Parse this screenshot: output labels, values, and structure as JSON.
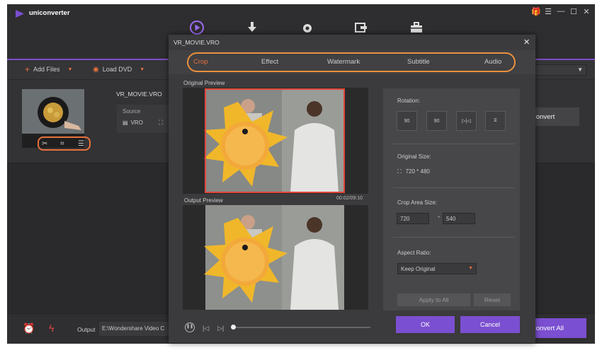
{
  "app": {
    "name": "uniconverter"
  },
  "window_controls": [
    "gift-icon",
    "menu-icon",
    "minimize-icon",
    "maximize-icon",
    "close-icon"
  ],
  "toolbar": {
    "add_files": "Add Files",
    "load_dvd": "Load DVD"
  },
  "file": {
    "name": "VR_MOVIE.VRO",
    "source_label": "Source",
    "source_format": "VRO"
  },
  "convert_button": "Convert",
  "bottom": {
    "output_label": "Output",
    "output_path": "E:\\Wondershare Video C",
    "convert_all": "Convert All"
  },
  "modal": {
    "title": "VR_MOVIE.VRO",
    "tabs": [
      {
        "label": "Crop",
        "active": true
      },
      {
        "label": "Effect",
        "active": false
      },
      {
        "label": "Watermark",
        "active": false
      },
      {
        "label": "Subtitle",
        "active": false
      },
      {
        "label": "Audio",
        "active": false
      }
    ],
    "original_preview_label": "Original Preview",
    "output_preview_label": "Output Preview",
    "timecode": "00:02/09:10",
    "rotation_label": "Rotation:",
    "rotation_buttons": [
      "90",
      "90"
    ],
    "original_size_label": "Original Size:",
    "original_size_value": "720 * 480",
    "crop_area_label": "Crop Area Size:",
    "crop_width": "720",
    "crop_height": "540",
    "crop_separator": "*",
    "aspect_ratio_label": "Aspect Ratio:",
    "aspect_ratio_value": "Keep Original",
    "apply_to_all": "Apply to All",
    "reset": "Reset",
    "ok": "OK",
    "cancel": "Cancel"
  },
  "colors": {
    "accent_orange": "#e8713d",
    "accent_purple": "#7b4fd1",
    "bg_dark": "#2b2b2b"
  }
}
